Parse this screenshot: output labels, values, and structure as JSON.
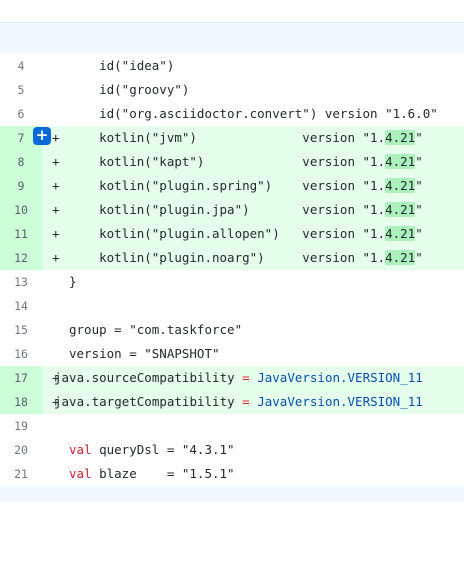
{
  "colors": {
    "added_row": "#e6ffec",
    "added_gutter": "#ccffd8",
    "highlight": "#abf2bc",
    "keyword": "#cf222e",
    "constant": "#0550ae",
    "hunk_bg": "#f1f8ff",
    "add_button": "#0969da"
  },
  "add_comment_button": {
    "icon": "plus-icon",
    "glyph": "+"
  },
  "lines": [
    {
      "num": "4",
      "sign": "",
      "added": false,
      "code": "    id(\"idea\")"
    },
    {
      "num": "5",
      "sign": "",
      "added": false,
      "code": "    id(\"groovy\")"
    },
    {
      "num": "6",
      "sign": "",
      "added": false,
      "code": "    id(\"org.asciidoctor.convert\") version \"1.6.0\""
    },
    {
      "num": "7",
      "sign": "+",
      "added": true,
      "code_pre": "    kotlin(\"jvm\")              version \"1.",
      "code_hl": "4.21",
      "code_post": "\""
    },
    {
      "num": "8",
      "sign": "+",
      "added": true,
      "code_pre": "    kotlin(\"kapt\")             version \"1.",
      "code_hl": "4.21",
      "code_post": "\""
    },
    {
      "num": "9",
      "sign": "+",
      "added": true,
      "code_pre": "    kotlin(\"plugin.spring\")    version \"1.",
      "code_hl": "4.21",
      "code_post": "\""
    },
    {
      "num": "10",
      "sign": "+",
      "added": true,
      "code_pre": "    kotlin(\"plugin.jpa\")       version \"1.",
      "code_hl": "4.21",
      "code_post": "\""
    },
    {
      "num": "11",
      "sign": "+",
      "added": true,
      "code_pre": "    kotlin(\"plugin.allopen\")   version \"1.",
      "code_hl": "4.21",
      "code_post": "\""
    },
    {
      "num": "12",
      "sign": "+",
      "added": true,
      "code_pre": "    kotlin(\"plugin.noarg\")     version \"1.",
      "code_hl": "4.21",
      "code_post": "\""
    },
    {
      "num": "13",
      "sign": "",
      "added": false,
      "code": "}"
    },
    {
      "num": "14",
      "sign": "",
      "added": false,
      "code": ""
    },
    {
      "num": "15",
      "sign": "",
      "added": false,
      "code": "group = \"com.taskforce\""
    },
    {
      "num": "16",
      "sign": "",
      "added": false,
      "code": "version = \"SNAPSHOT\""
    },
    {
      "num": "17",
      "sign": "+",
      "added": true,
      "code_pre": "java.sourceCompatibility ",
      "code_eq": "=",
      "code_const": " JavaVersion.VERSION_11"
    },
    {
      "num": "18",
      "sign": "+",
      "added": true,
      "code_pre": "java.targetCompatibility ",
      "code_eq": "=",
      "code_const": " JavaVersion.VERSION_11"
    },
    {
      "num": "19",
      "sign": "",
      "added": false,
      "code": ""
    },
    {
      "num": "20",
      "sign": "",
      "added": false,
      "code_kw": "val",
      "code_post": " queryDsl = \"4.3.1\""
    },
    {
      "num": "21",
      "sign": "",
      "added": false,
      "code_kw": "val",
      "code_post": " blaze    = \"1.5.1\""
    }
  ]
}
